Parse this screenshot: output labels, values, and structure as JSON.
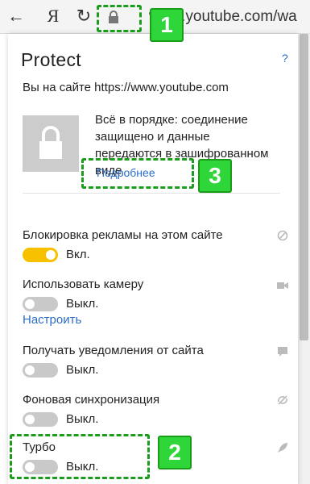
{
  "toolbar": {
    "back_glyph": "←",
    "yandex_glyph": "Я",
    "reload_glyph": "↻",
    "url": "www.youtube.com/wa"
  },
  "panel": {
    "title": "Protect",
    "help": "?",
    "site_info": "Вы на сайте https://www.youtube.com",
    "secure_text": "Всё в порядке: соединение защищено и данные передаются в зашифрованном виде",
    "more_link": "Подробнее",
    "settings": [
      {
        "label": "Блокировка рекламы на этом сайте",
        "state": "Вкл.",
        "on": true,
        "icon": "block-icon"
      },
      {
        "label": "Использовать камеру",
        "state": "Выкл.",
        "on": false,
        "icon": "camera-icon",
        "link": "Настроить"
      },
      {
        "label": "Получать уведомления от сайта",
        "state": "Выкл.",
        "on": false,
        "icon": "notification-icon"
      },
      {
        "label": "Фоновая синхронизация",
        "state": "Выкл.",
        "on": false,
        "icon": "sync-icon"
      },
      {
        "label": "Турбо",
        "state": "Выкл.",
        "on": false,
        "icon": "rocket-icon"
      }
    ]
  },
  "callouts": [
    "1",
    "2",
    "3"
  ],
  "colors": {
    "accent_link": "#2a6dc7",
    "toggle_on": "#f8c100",
    "toggle_off": "#c9c9c9",
    "callout_green": "#2fd63a"
  }
}
